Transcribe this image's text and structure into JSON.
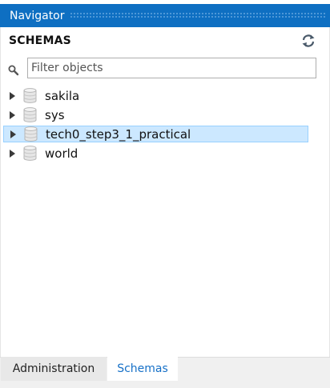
{
  "title": "Navigator",
  "schemas_header": "SCHEMAS",
  "search": {
    "placeholder": "Filter objects",
    "value": ""
  },
  "schemas": [
    {
      "name": "sakila",
      "icon": "database-icon",
      "selected": false
    },
    {
      "name": "sys",
      "icon": "database-icon",
      "selected": false
    },
    {
      "name": "tech0_step3_1_practical",
      "icon": "database-icon",
      "selected": true
    },
    {
      "name": "world",
      "icon": "database-icon",
      "selected": false
    }
  ],
  "tabs": [
    {
      "label": "Administration",
      "active": false
    },
    {
      "label": "Schemas",
      "active": true
    }
  ],
  "colors": {
    "titlebar": "#0e6fc2",
    "selection": "#cce8ff",
    "selection_border": "#99d1ff",
    "active_tab_text": "#1670c7"
  },
  "icons": {
    "refresh": "refresh-icon",
    "search": "search-icon",
    "expander": "expand-arrow-icon"
  }
}
